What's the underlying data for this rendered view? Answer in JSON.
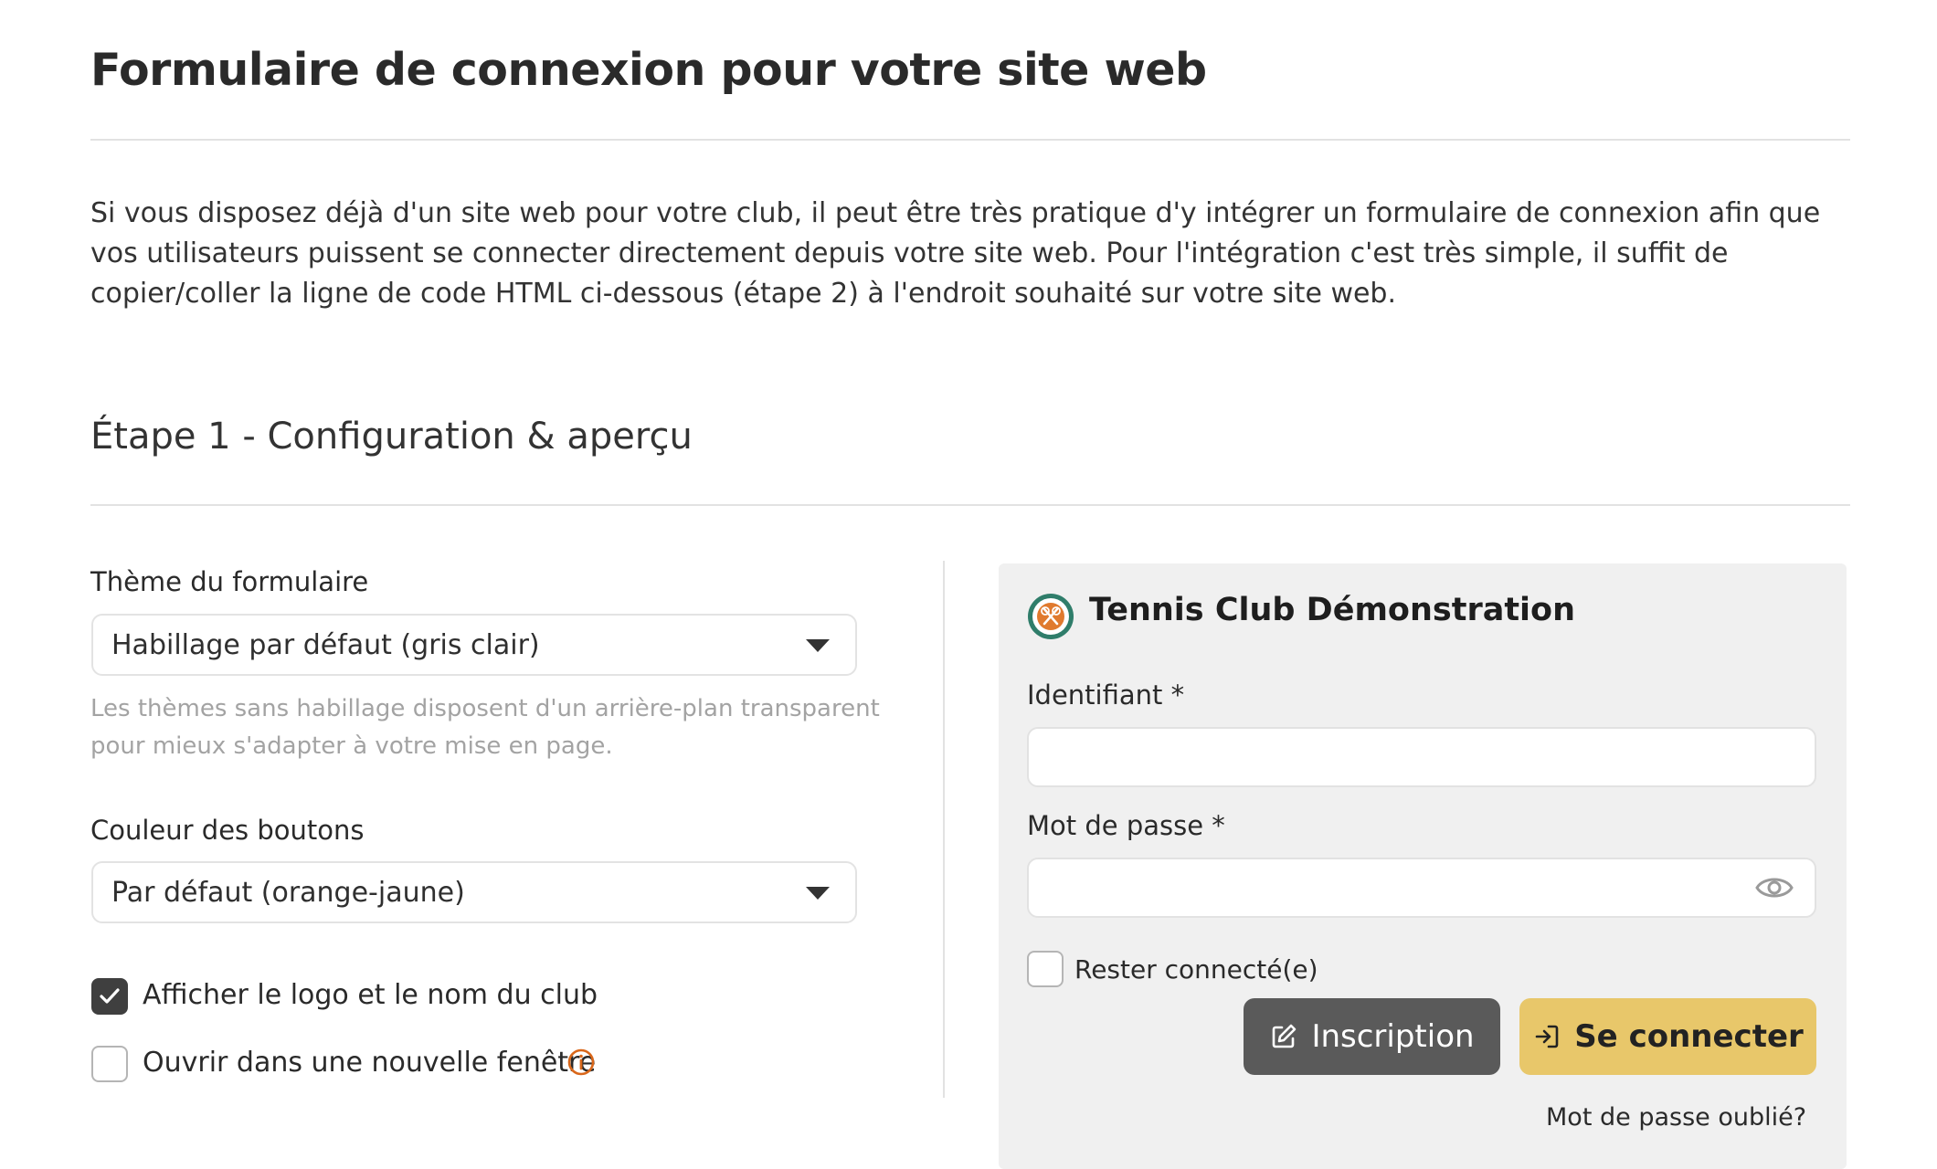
{
  "page": {
    "title": "Formulaire de connexion pour votre site web",
    "intro": "Si vous disposez déjà d'un site web pour votre club, il peut être très pratique d'y intégrer un formulaire de connexion afin que vos utilisateurs puissent se connecter directement depuis votre site web. Pour l'intégration c'est très simple, il suffit de copier/coller la ligne de code HTML ci-dessous (étape 2) à l'endroit souhaité sur votre site web.",
    "step_title": "Étape 1 - Configuration & aperçu"
  },
  "config": {
    "theme_label": "Thème du formulaire",
    "theme_value": "Habillage par défaut (gris clair)",
    "theme_hint": "Les thèmes sans habillage disposent d'un arrière-plan transparent pour mieux s'adapter à votre mise en page.",
    "color_label": "Couleur des boutons",
    "color_value": "Par défaut (orange-jaune)",
    "show_logo_label": "Afficher le logo et le nom du club",
    "show_logo_checked": true,
    "new_window_label": "Ouvrir dans une nouvelle fenêtre",
    "new_window_checked": false,
    "info_icon": "info-circle-icon",
    "info_color": "#d9671a"
  },
  "preview": {
    "club_name": "Tennis Club Démonstration",
    "logo_icon": "club-logo-icon",
    "username_label": "Identifiant *",
    "username_value": "",
    "password_label": "Mot de passe *",
    "password_value": "",
    "show_password_icon": "eye-icon",
    "remember_label": "Rester connecté(e)",
    "remember_checked": false,
    "register_label": "Inscription",
    "register_icon": "edit-icon",
    "login_label": "Se connecter",
    "login_icon": "sign-in-icon",
    "forgot_label": "Mot de passe oublié?",
    "colors": {
      "panel_bg": "#f0f0f0",
      "register_bg": "#5a5a5a",
      "login_bg": "#e8c76a"
    }
  }
}
